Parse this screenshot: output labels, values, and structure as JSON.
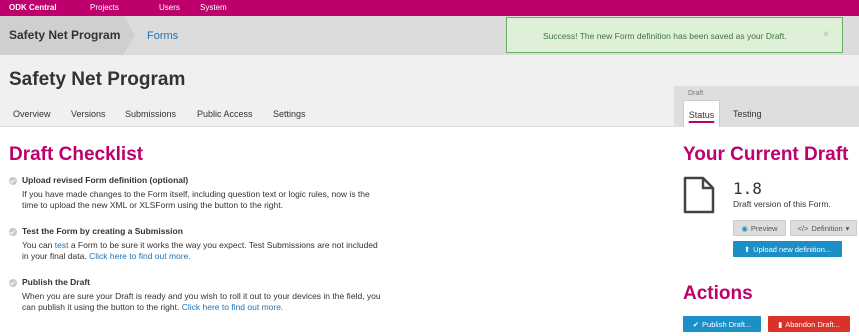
{
  "topnav": {
    "brand": "ODK Central",
    "items": [
      "Projects",
      "Users",
      "System"
    ]
  },
  "breadcrumb": {
    "project": "Safety Net Program",
    "current": "Forms"
  },
  "alert": {
    "message": "Success! The new Form definition has been saved as your Draft.",
    "close": "×"
  },
  "page": {
    "title": "Safety Net Program"
  },
  "tabs": [
    "Overview",
    "Versions",
    "Submissions",
    "Public Access",
    "Settings"
  ],
  "draft_panel": {
    "label": "Draft",
    "tabs": [
      "Status",
      "Testing"
    ],
    "active_tab": "Status"
  },
  "checklist": {
    "heading": "Draft Checklist",
    "items": [
      {
        "title": "Upload revised Form definition (optional)",
        "line1": "If you have made changes to the Form itself, including question text or logic rules, now is the",
        "line2": "time to upload the new XML or XLSForm using the button to the right."
      },
      {
        "title": "Test the Form by creating a Submission",
        "pre": "You can ",
        "link1": "test",
        "mid": " a Form to be sure it works the way you expect. Test Submissions are not included",
        "pre2": "in your final data. ",
        "link2": "Click here to find out more."
      },
      {
        "title": "Publish the Draft",
        "line1": "When you are sure your Draft is ready and you wish to roll it out to your devices in the field, you",
        "pre2": "can publish it using the button to the right. ",
        "link2": "Click here to find out more."
      }
    ]
  },
  "current_draft": {
    "heading": "Your Current Draft",
    "version": "1.8",
    "description": "Draft version of this Form.",
    "preview_label": "Preview",
    "definition_label": "Definition",
    "upload_label": "Upload new definition..."
  },
  "actions": {
    "heading": "Actions",
    "publish_label": "Publish Draft...",
    "abandon_label": "Abandon Draft..."
  }
}
